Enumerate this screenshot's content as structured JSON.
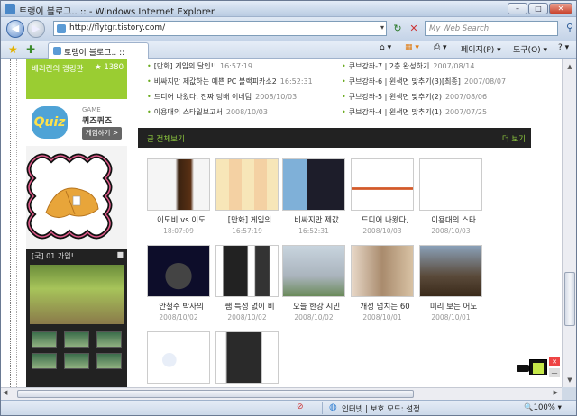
{
  "window": {
    "title": "토랭이 블로그.. :: - Windows Internet Explorer",
    "min_label": "–",
    "max_label": "□",
    "close_label": "✕"
  },
  "nav": {
    "back_glyph": "◀",
    "forward_glyph": "▶",
    "url": "http://flytgr.tistory.com/",
    "refresh_glyph": "↻",
    "stop_glyph": "✕",
    "search_placeholder": "My Web Search",
    "search_glyph": "⚲"
  },
  "tabs": [
    {
      "label": "토랭이 블로그.. ::"
    }
  ],
  "toolbar": {
    "home_label": "⌂ ▾",
    "feeds_label": "▦ ▾",
    "print_label": "⎙ ▾",
    "page_label": "페이지(P) ▾",
    "tools_label": "도구(O) ▾",
    "help_label": "? ▾"
  },
  "sidebar": {
    "rank_title": "베리킨의 랭킹판",
    "rank_value": "★ 1380",
    "quiz_logo": "Quiz",
    "quiz_game_label": "GAME",
    "quiz_name": "퀴즈퀴즈",
    "quiz_button": "게임하기 >",
    "dark_header": "[국] 01 가입!",
    "dark_header_icon": "■"
  },
  "posts_left": [
    {
      "title": "[만화] 게임의 달인!!",
      "date": "16:57:19"
    },
    {
      "title": "비싸지만 제값하는 예쁜 PC 블랙피카소2",
      "date": "16:52:31"
    },
    {
      "title": "드디어 나왔다, 진짜 덩배 이네텀",
      "date": "2008/10/03"
    },
    {
      "title": "이용대의 스타일보고서",
      "date": "2008/10/03"
    }
  ],
  "posts_right": [
    {
      "title": "큐브강좌-7 | 2층 완성하기",
      "date": "2007/08/14"
    },
    {
      "title": "큐브강좌-6 | 윈색면 맞추기(3)[최종]",
      "date": "2007/08/07"
    },
    {
      "title": "큐브강좌-5 | 윈색면 맞추기(2)",
      "date": "2007/08/06"
    },
    {
      "title": "큐브강좌-4 | 윈색면 맞추기(1)",
      "date": "2007/07/25"
    }
  ],
  "post_bullet": "•",
  "section": {
    "title": "글 전체보기",
    "more": "더 보기"
  },
  "cards": [
    {
      "title": "이도비 vs 이도",
      "date": "18:07:09"
    },
    {
      "title": "[만화] 게임의",
      "date": "16:57:19"
    },
    {
      "title": "비싸지만 제값",
      "date": "16:52:31"
    },
    {
      "title": "드디어 나왔다,",
      "date": "2008/10/03"
    },
    {
      "title": "이용대의 스타",
      "date": "2008/10/03"
    },
    {
      "title": "안철수 박사의",
      "date": "2008/10/02"
    },
    {
      "title": "쌤 특성 없이 비",
      "date": "2008/10/02"
    },
    {
      "title": "오늘 한강 시민",
      "date": "2008/10/02"
    },
    {
      "title": "개성 넘치는 60",
      "date": "2008/10/01"
    },
    {
      "title": "미리 보는 어도",
      "date": "2008/10/01"
    },
    {
      "title": "",
      "date": ""
    },
    {
      "title": "",
      "date": ""
    }
  ],
  "status": {
    "zone": "인터넷 | 보호 모드: 설정",
    "zoom": "🔍100% ▾",
    "globe_glyph": "◍",
    "security_glyph": "⊘"
  },
  "scroll": {
    "up": "▲",
    "down": "▼",
    "left": "◀",
    "right": "▶"
  },
  "gadget": {
    "red_glyph": "✕",
    "gray_glyph": "—"
  },
  "colors": {
    "accent_green": "#8cc63e",
    "rank_green": "#9acd32",
    "bar_dark": "#222222"
  }
}
